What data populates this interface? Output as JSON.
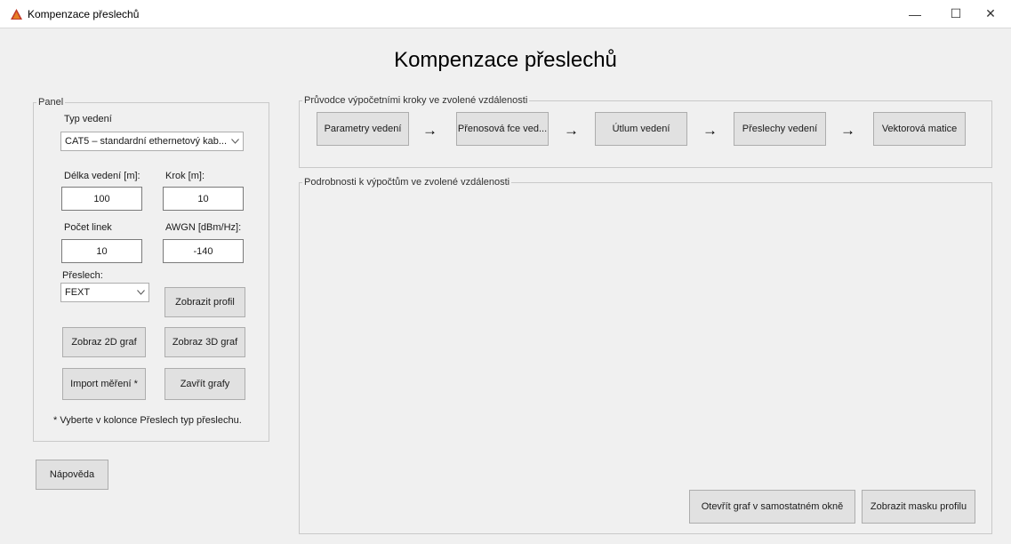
{
  "window": {
    "title": "Kompenzace přeslechů",
    "minimize_glyph": "—",
    "maximize_glyph": "☐",
    "close_glyph": "✕"
  },
  "heading": "Kompenzace přeslechů",
  "panel": {
    "legend": "Panel",
    "line_type_label": "Typ vedení",
    "line_type_value": "CAT5 – standardní ethernetový kab...",
    "length_label": "Délka vedení [m]:",
    "length_value": "100",
    "step_label": "Krok [m]:",
    "step_value": "10",
    "lines_label": "Počet linek",
    "lines_value": "10",
    "awgn_label": "AWGN [dBm/Hz]:",
    "awgn_value": "-140",
    "crosstalk_label": "Přeslech:",
    "crosstalk_value": "FEXT",
    "show_profile_button": "Zobrazit profil",
    "plot2d_button": "Zobraz 2D graf",
    "plot3d_button": "Zobraz 3D graf",
    "import_button": "Import měření *",
    "close_plots_button": "Zavřít grafy",
    "footnote": "* Vyberte v kolonce Přeslech typ přeslechu."
  },
  "help_button": "Nápověda",
  "guide": {
    "legend": "Průvodce výpočetními kroky ve zvolené vzdálenosti",
    "arrow_glyph": "→",
    "steps": [
      "Parametry vedení",
      "Přenosová fce ved...",
      "Útlum vedení",
      "Přeslechy vedení",
      "Vektorová matice"
    ]
  },
  "details": {
    "legend": "Podrobnosti k výpočtům ve zvolené vzdálenosti",
    "open_plot_button": "Otevřít graf v samostatném okně",
    "show_mask_button": "Zobrazit masku profilu"
  },
  "colors": {
    "background": "#f0f0f0",
    "button": "#e1e1e1",
    "border": "#adadad",
    "app_icon_red": "#c0392b"
  },
  "icons": {
    "app": "matlab-icon",
    "dropdown": "chevron-down-icon",
    "minimize": "minimize-icon",
    "maximize": "maximize-icon",
    "close": "close-icon"
  }
}
